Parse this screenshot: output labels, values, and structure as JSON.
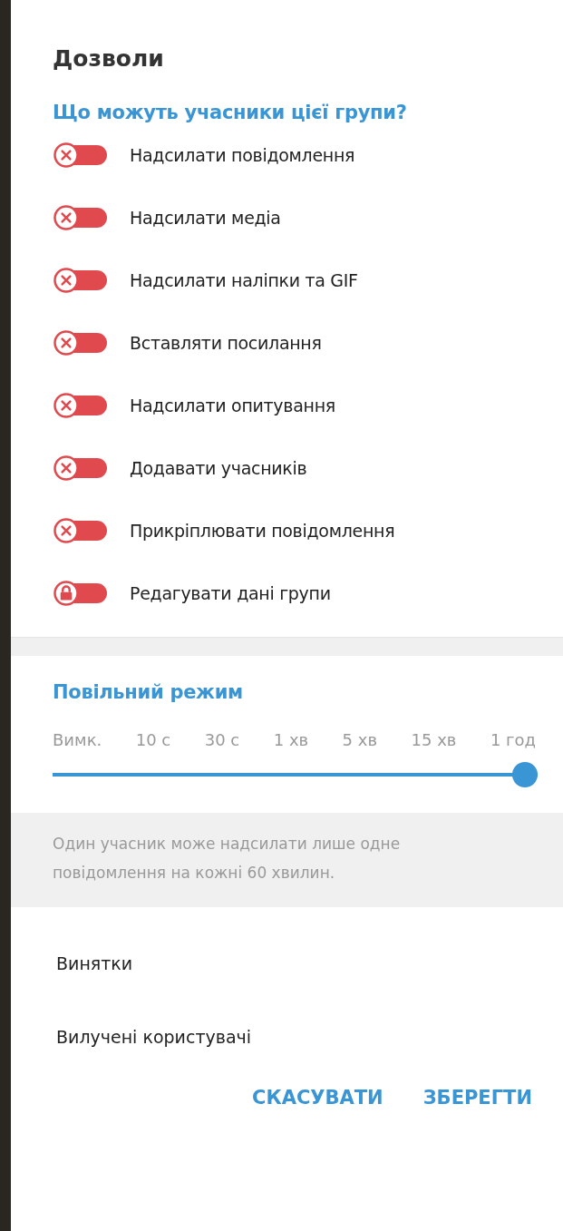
{
  "title": "Дозволи",
  "permissions_heading": "Що можуть учасники цієї групи?",
  "permissions": [
    {
      "label": "Надсилати повідомлення",
      "on": false,
      "locked": false
    },
    {
      "label": "Надсилати медіа",
      "on": false,
      "locked": false
    },
    {
      "label": "Надсилати наліпки та GIF",
      "on": false,
      "locked": false
    },
    {
      "label": "Вставляти посилання",
      "on": false,
      "locked": false
    },
    {
      "label": "Надсилати опитування",
      "on": false,
      "locked": false
    },
    {
      "label": "Додавати учасників",
      "on": false,
      "locked": false
    },
    {
      "label": "Прикріплювати повідомлення",
      "on": false,
      "locked": false
    },
    {
      "label": "Редагувати дані групи",
      "on": false,
      "locked": true
    }
  ],
  "slow_mode": {
    "heading": "Повільний режим",
    "labels": [
      "Вимк.",
      "10 с",
      "30 с",
      "1 хв",
      "5 хв",
      "15 хв",
      "1 год"
    ],
    "level": 1,
    "description": "Один учасник може надсилати лише одне повідомлення на кожні 60 хвилин."
  },
  "links": [
    "Винятки",
    "Вилучені користувачі"
  ],
  "buttons": [
    "СКАСУВАТИ",
    "ЗБЕРЕГТИ"
  ]
}
